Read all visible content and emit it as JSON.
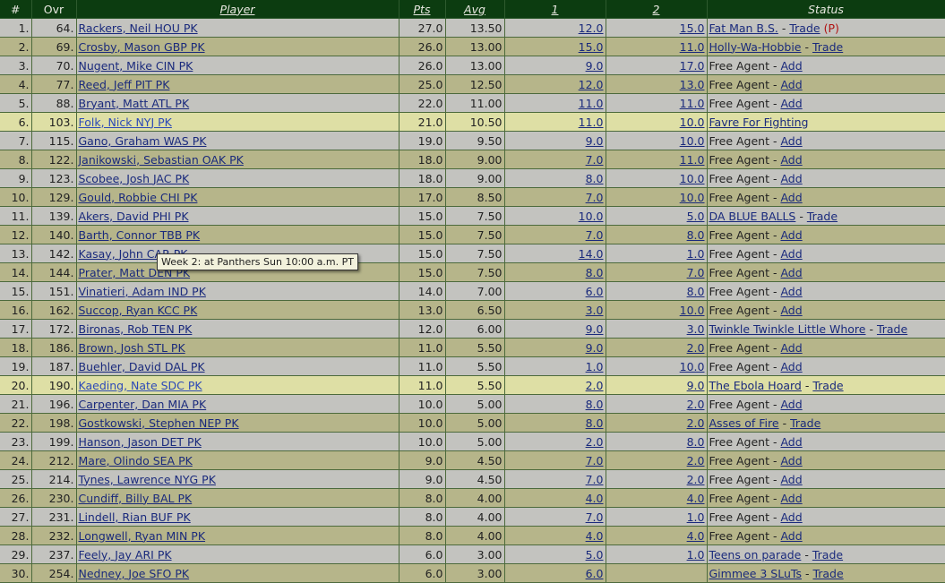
{
  "headers": {
    "rank": "#",
    "ovr": "Ovr",
    "player": "Player",
    "pts": "Pts",
    "avg": "Avg",
    "w1": "1",
    "w2": "2",
    "status": "Status"
  },
  "tooltip": "Week 2: at Panthers Sun 10:00 a.m. PT",
  "rows": [
    {
      "rank": "1.",
      "ovr": "64.",
      "player": "Rackers, Neil HOU PK",
      "pts": "27.0",
      "avg": "13.50",
      "w1": "12.0",
      "w2": "15.0",
      "owner": "Fat Man B.S.",
      "action": "Trade",
      "flag": "(P)"
    },
    {
      "rank": "2.",
      "ovr": "69.",
      "player": "Crosby, Mason GBP PK",
      "pts": "26.0",
      "avg": "13.00",
      "w1": "15.0",
      "w2": "11.0",
      "owner": "Holly-Wa-Hobbie",
      "action": "Trade"
    },
    {
      "rank": "3.",
      "ovr": "70.",
      "player": "Nugent, Mike CIN PK",
      "pts": "26.0",
      "avg": "13.00",
      "w1": "9.0",
      "w2": "17.0",
      "free": "Free Agent",
      "action": "Add"
    },
    {
      "rank": "4.",
      "ovr": "77.",
      "player": "Reed, Jeff PIT PK",
      "pts": "25.0",
      "avg": "12.50",
      "w1": "12.0",
      "w2": "13.0",
      "free": "Free Agent",
      "action": "Add"
    },
    {
      "rank": "5.",
      "ovr": "88.",
      "player": "Bryant, Matt ATL PK",
      "pts": "22.0",
      "avg": "11.00",
      "w1": "11.0",
      "w2": "11.0",
      "free": "Free Agent",
      "action": "Add"
    },
    {
      "rank": "6.",
      "ovr": "103.",
      "player": "Folk, Nick NYJ PK",
      "pts": "21.0",
      "avg": "10.50",
      "w1": "11.0",
      "w2": "10.0",
      "owner": "Favre For Fighting",
      "highlight": true
    },
    {
      "rank": "7.",
      "ovr": "115.",
      "player": "Gano, Graham WAS PK",
      "pts": "19.0",
      "avg": "9.50",
      "w1": "9.0",
      "w2": "10.0",
      "free": "Free Agent",
      "action": "Add"
    },
    {
      "rank": "8.",
      "ovr": "122.",
      "player": "Janikowski, Sebastian OAK PK",
      "pts": "18.0",
      "avg": "9.00",
      "w1": "7.0",
      "w2": "11.0",
      "free": "Free Agent",
      "action": "Add"
    },
    {
      "rank": "9.",
      "ovr": "123.",
      "player": "Scobee, Josh JAC PK",
      "pts": "18.0",
      "avg": "9.00",
      "w1": "8.0",
      "w2": "10.0",
      "free": "Free Agent",
      "action": "Add"
    },
    {
      "rank": "10.",
      "ovr": "129.",
      "player": "Gould, Robbie CHI PK",
      "pts": "17.0",
      "avg": "8.50",
      "w1": "7.0",
      "w2": "10.0",
      "free": "Free Agent",
      "action": "Add"
    },
    {
      "rank": "11.",
      "ovr": "139.",
      "player": "Akers, David PHI PK",
      "pts": "15.0",
      "avg": "7.50",
      "w1": "10.0",
      "w2": "5.0",
      "owner": "DA BLUE BALLS",
      "action": "Trade"
    },
    {
      "rank": "12.",
      "ovr": "140.",
      "player": "Barth, Connor TBB PK",
      "pts": "15.0",
      "avg": "7.50",
      "w1": "7.0",
      "w2": "8.0",
      "free": "Free Agent",
      "action": "Add"
    },
    {
      "rank": "13.",
      "ovr": "142.",
      "player": "Kasay, John CAR PK",
      "pts": "15.0",
      "avg": "7.50",
      "w1": "14.0",
      "w2": "1.0",
      "free": "Free Agent",
      "action": "Add"
    },
    {
      "rank": "14.",
      "ovr": "144.",
      "player": "Prater, Matt DEN PK",
      "pts": "15.0",
      "avg": "7.50",
      "w1": "8.0",
      "w2": "7.0",
      "free": "Free Agent",
      "action": "Add"
    },
    {
      "rank": "15.",
      "ovr": "151.",
      "player": "Vinatieri, Adam IND PK",
      "pts": "14.0",
      "avg": "7.00",
      "w1": "6.0",
      "w2": "8.0",
      "free": "Free Agent",
      "action": "Add"
    },
    {
      "rank": "16.",
      "ovr": "162.",
      "player": "Succop, Ryan KCC PK",
      "pts": "13.0",
      "avg": "6.50",
      "w1": "3.0",
      "w2": "10.0",
      "free": "Free Agent",
      "action": "Add"
    },
    {
      "rank": "17.",
      "ovr": "172.",
      "player": "Bironas, Rob TEN PK",
      "pts": "12.0",
      "avg": "6.00",
      "w1": "9.0",
      "w2": "3.0",
      "owner": "Twinkle Twinkle Little Whore",
      "action": "Trade"
    },
    {
      "rank": "18.",
      "ovr": "186.",
      "player": "Brown, Josh STL PK",
      "pts": "11.0",
      "avg": "5.50",
      "w1": "9.0",
      "w2": "2.0",
      "free": "Free Agent",
      "action": "Add"
    },
    {
      "rank": "19.",
      "ovr": "187.",
      "player": "Buehler, David DAL PK",
      "pts": "11.0",
      "avg": "5.50",
      "w1": "1.0",
      "w2": "10.0",
      "free": "Free Agent",
      "action": "Add"
    },
    {
      "rank": "20.",
      "ovr": "190.",
      "player": "Kaeding, Nate SDC PK",
      "pts": "11.0",
      "avg": "5.50",
      "w1": "2.0",
      "w2": "9.0",
      "owner": "The Ebola Hoard",
      "action": "Trade",
      "highlight": true
    },
    {
      "rank": "21.",
      "ovr": "196.",
      "player": "Carpenter, Dan MIA PK",
      "pts": "10.0",
      "avg": "5.00",
      "w1": "8.0",
      "w2": "2.0",
      "free": "Free Agent",
      "action": "Add"
    },
    {
      "rank": "22.",
      "ovr": "198.",
      "player": "Gostkowski, Stephen NEP PK",
      "pts": "10.0",
      "avg": "5.00",
      "w1": "8.0",
      "w2": "2.0",
      "owner": "Asses of Fire",
      "action": "Trade"
    },
    {
      "rank": "23.",
      "ovr": "199.",
      "player": "Hanson, Jason DET PK",
      "pts": "10.0",
      "avg": "5.00",
      "w1": "2.0",
      "w2": "8.0",
      "free": "Free Agent",
      "action": "Add"
    },
    {
      "rank": "24.",
      "ovr": "212.",
      "player": "Mare, Olindo SEA PK",
      "pts": "9.0",
      "avg": "4.50",
      "w1": "7.0",
      "w2": "2.0",
      "free": "Free Agent",
      "action": "Add"
    },
    {
      "rank": "25.",
      "ovr": "214.",
      "player": "Tynes, Lawrence NYG PK",
      "pts": "9.0",
      "avg": "4.50",
      "w1": "7.0",
      "w2": "2.0",
      "free": "Free Agent",
      "action": "Add"
    },
    {
      "rank": "26.",
      "ovr": "230.",
      "player": "Cundiff, Billy BAL PK",
      "pts": "8.0",
      "avg": "4.00",
      "w1": "4.0",
      "w2": "4.0",
      "free": "Free Agent",
      "action": "Add"
    },
    {
      "rank": "27.",
      "ovr": "231.",
      "player": "Lindell, Rian BUF PK",
      "pts": "8.0",
      "avg": "4.00",
      "w1": "7.0",
      "w2": "1.0",
      "free": "Free Agent",
      "action": "Add"
    },
    {
      "rank": "28.",
      "ovr": "232.",
      "player": "Longwell, Ryan MIN PK",
      "pts": "8.0",
      "avg": "4.00",
      "w1": "4.0",
      "w2": "4.0",
      "free": "Free Agent",
      "action": "Add"
    },
    {
      "rank": "29.",
      "ovr": "237.",
      "player": "Feely, Jay ARI PK",
      "pts": "6.0",
      "avg": "3.00",
      "w1": "5.0",
      "w2": "1.0",
      "owner": "Teens on parade",
      "action": "Trade"
    },
    {
      "rank": "30.",
      "ovr": "254.",
      "player": "Nedney, Joe SFO PK",
      "pts": "6.0",
      "avg": "3.00",
      "w1": "6.0",
      "w2": "",
      "owner": "Gimmee 3 SLuTs",
      "action": "Trade"
    }
  ]
}
